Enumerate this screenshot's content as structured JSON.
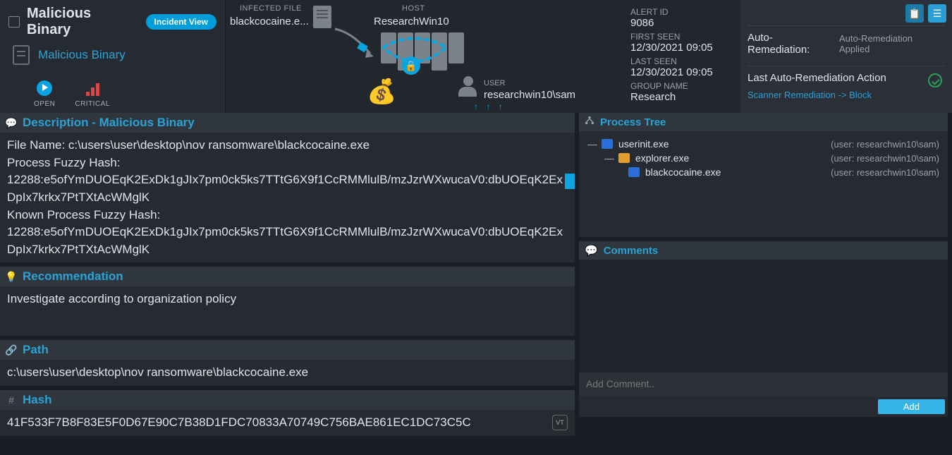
{
  "header": {
    "title": "Malicious Binary",
    "view_pill": "Incident View",
    "subtitle": "Malicious Binary",
    "status_open": "OPEN",
    "status_critical": "CRITICAL"
  },
  "graph": {
    "infected_label": "INFECTED FILE",
    "infected_filename": "blackcocaine.e...",
    "host_label": "HOST",
    "host_name": "ResearchWin10",
    "user_label": "USER",
    "user_name": "researchwin10\\sam",
    "upload_arrows": "↑ ↑ ↑"
  },
  "meta": {
    "alert_id_label": "ALERT ID",
    "alert_id": "9086",
    "first_seen_label": "FIRST SEEN",
    "first_seen": "12/30/2021 09:05",
    "last_seen_label": "LAST SEEN",
    "last_seen": "12/30/2021 09:05",
    "group_label": "GROUP NAME",
    "group": "Research"
  },
  "remediation": {
    "auto_label": "Auto-Remediation:",
    "auto_value": "Auto-Remediation Applied",
    "last_action_label": "Last Auto-Remediation Action",
    "last_action_link": "Scanner Remediation -> Block"
  },
  "description": {
    "title": "Description - Malicious Binary",
    "file_name_label": "File Name: ",
    "file_name": "c:\\users\\user\\desktop\\nov ransomware\\blackcocaine.exe",
    "pfh_label": "Process Fuzzy Hash:",
    "pfh": "12288:e5ofYmDUOEqK2ExDk1gJIx7pm0ck5ks7TTtG6X9f1CcRMMlulB/mzJzrWXwucaV0:dbUOEqK2ExDpIx7krkx7PtTXtAcWMglK",
    "kpfh_label": "Known Process Fuzzy Hash:",
    "kpfh": "12288:e5ofYmDUOEqK2ExDk1gJIx7pm0ck5ks7TTtG6X9f1CcRMMlulB/mzJzrWXwucaV0:dbUOEqK2ExDpIx7krkx7PtTXtAcWMglK"
  },
  "recommendation": {
    "title": "Recommendation",
    "text": "Investigate according to organization policy"
  },
  "path": {
    "title": "Path",
    "value": "c:\\users\\user\\desktop\\nov ransomware\\blackcocaine.exe"
  },
  "hash": {
    "title": "Hash",
    "value": "41F533F7B8F83E5F0D67E90C7B38D1FDC70833A70749C756BAE861EC1DC73C5C",
    "vt_label": "VT"
  },
  "process_tree": {
    "title": "Process Tree",
    "nodes": [
      {
        "name": "userinit.exe",
        "user": "(user: researchwin10\\sam)"
      },
      {
        "name": "explorer.exe",
        "user": "(user: researchwin10\\sam)"
      },
      {
        "name": "blackcocaine.exe",
        "user": "(user: researchwin10\\sam)"
      }
    ]
  },
  "comments": {
    "title": "Comments",
    "placeholder": "Add Comment..",
    "add_button": "Add"
  }
}
